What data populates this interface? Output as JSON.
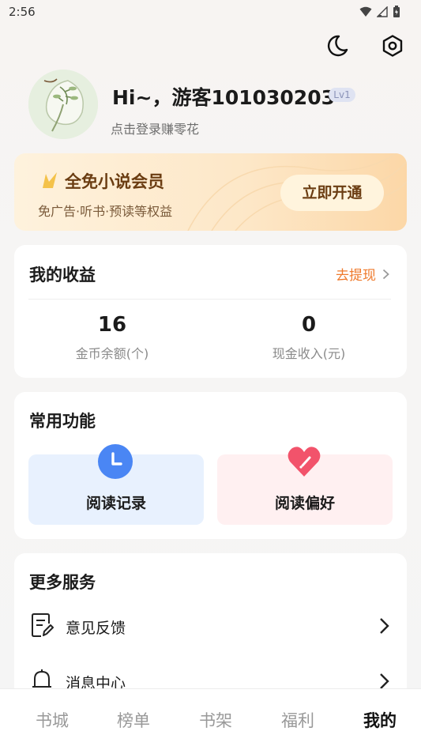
{
  "status_bar": {
    "time": "2:56"
  },
  "header": {
    "theme_icon": "moon-icon",
    "settings_icon": "settings-gear-icon"
  },
  "profile": {
    "greeting": "Hi~，游客101030203",
    "level": "Lv1",
    "login_hint": "点击登录赚零花"
  },
  "vip": {
    "title": "全免小说会员",
    "subtitle": "免广告·听书·预读等权益",
    "button": "立即开通"
  },
  "earnings": {
    "title": "我的收益",
    "withdraw": "去提现",
    "stats": [
      {
        "value": "16",
        "label": "金币余额(个)"
      },
      {
        "value": "0",
        "label": "现金收入(元)"
      }
    ]
  },
  "features": {
    "title": "常用功能",
    "items": [
      {
        "label": "阅读记录",
        "icon": "clock-icon",
        "bg": "#e8f1fe"
      },
      {
        "label": "阅读偏好",
        "icon": "heart-icon",
        "bg": "#fff0f1"
      }
    ]
  },
  "services": {
    "title": "更多服务",
    "items": [
      {
        "label": "意见反馈",
        "icon": "feedback-doc-icon"
      },
      {
        "label": "消息中心",
        "icon": "bell-icon"
      }
    ]
  },
  "bottom_nav": {
    "items": [
      {
        "label": "书城"
      },
      {
        "label": "榜单"
      },
      {
        "label": "书架"
      },
      {
        "label": "福利"
      },
      {
        "label": "我的"
      }
    ],
    "active_index": 4
  },
  "colors": {
    "accent_orange": "#ef7a2c",
    "vip_brown": "#6b3d12",
    "clock_blue": "#4a86f4",
    "heart_red": "#f2536b"
  }
}
